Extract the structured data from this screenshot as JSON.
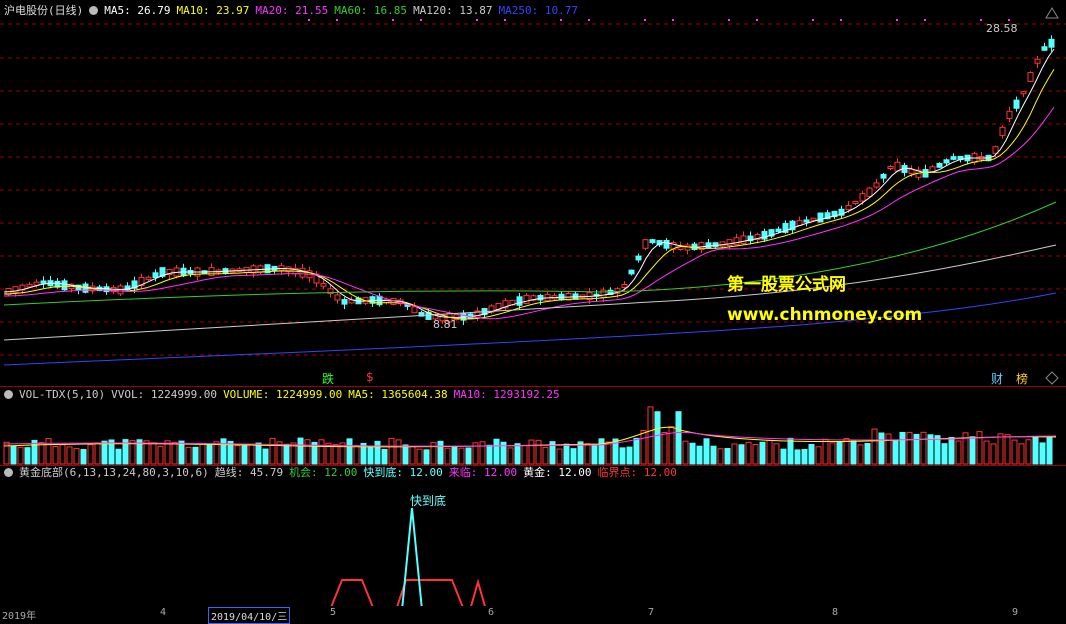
{
  "main": {
    "stock": "沪电股份(日线)",
    "ma": [
      {
        "label": "MA5: 26.79",
        "color": "#ffffff"
      },
      {
        "label": "MA10: 23.97",
        "color": "#ffff00"
      },
      {
        "label": "MA20: 21.55",
        "color": "#ff33ff"
      },
      {
        "label": "MA60: 16.85",
        "color": "#33cc33"
      },
      {
        "label": "MA120: 13.87",
        "color": "#cccccc"
      },
      {
        "label": "MA250: 10.77",
        "color": "#3344ff"
      }
    ],
    "high_label": "28.58",
    "low_label": "8.81",
    "watermark_cn": "第一股票公式网",
    "watermark_url": "www.chnmoney.com",
    "event_tags": [
      {
        "text": "跌",
        "color": "#33ff33"
      },
      {
        "text": "$",
        "color": "#ff3333"
      },
      {
        "text": "财",
        "color": "#66ccff"
      },
      {
        "text": "榜",
        "color": "#ffcc33"
      }
    ]
  },
  "volume": {
    "name": "VOL-TDX(5,10)",
    "items": [
      {
        "label": "VVOL: 1224999.00",
        "color": "#cccccc"
      },
      {
        "label": "VOLUME: 1224999.00",
        "color": "#ffff00"
      },
      {
        "label": "MA5: 1365604.38",
        "color": "#ffff00"
      },
      {
        "label": "MA10: 1293192.25",
        "color": "#ff33ff"
      }
    ]
  },
  "indicator": {
    "name": "黄金底部(6,13,13,24,80,3,10,6)",
    "items": [
      {
        "label": "趋线: 45.79",
        "color": "#cccccc"
      },
      {
        "label": "机会: 12.00",
        "color": "#33cc33"
      },
      {
        "label": "快到底: 12.00",
        "color": "#66ffff"
      },
      {
        "label": "来临: 12.00",
        "color": "#ff33ff"
      },
      {
        "label": "黄金: 12.00",
        "color": "#ffffff"
      },
      {
        "label": "临界点: 12.00",
        "color": "#ff3333"
      }
    ],
    "peak_label": "快到底"
  },
  "date_axis": {
    "labels": [
      "2019年",
      "4",
      "2019/04/10/三",
      "5",
      "6",
      "7",
      "8",
      "9"
    ],
    "selected_index": 2
  },
  "colors": {
    "up": "#ff3333",
    "down": "#54ffff",
    "grid": "#a00000",
    "bg": "#000000"
  }
}
